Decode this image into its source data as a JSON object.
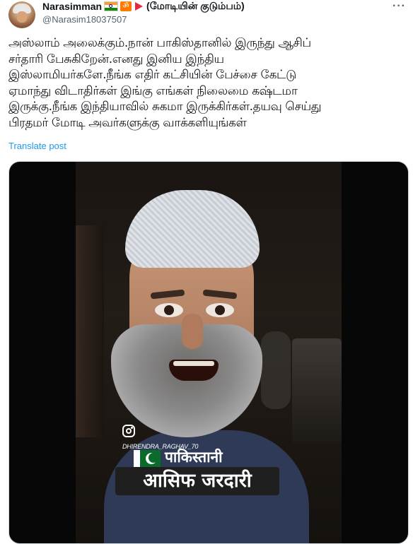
{
  "tweet": {
    "author": {
      "display_name": "Narasimman",
      "name_emojis": [
        "india-flag-icon",
        "om-icon",
        "red-pennant-icon"
      ],
      "tagline": "(மோடியின் குடும்பம்)",
      "handle": "@Narasim18037507"
    },
    "more_icon_label": "···",
    "text_lines": [
      "அஸ்லாம் அலைக்கும்.நான் பாகிஸ்தானில் இருந்து ஆசிப்",
      "சர்தாரி பேசுகிறேன்.எனது இனிய இந்திய",
      "இஸ்லாமியர்களே.நீங்க எதிர் கட்சியின் பேச்சை கேட்டு",
      "ஏமாந்து விடாதிர்கள் இங்கு எங்கள் நிலைமை கஷ்டமா",
      "இருக்கு.நீங்க இந்தியாவில் சுகமா இருக்கிர்கள்.தயவு செய்து",
      "பிரதமர் மோடி  அவர்களுக்கு வாக்களியுங்கள்"
    ],
    "translate_label": "Translate post",
    "media": {
      "watermark": "DHIRENDRA_RAGHAV_70",
      "caption_top": "पाकिस्तानी",
      "caption_main": "आसिफ जरदारी"
    }
  },
  "colors": {
    "text": "#0f1419",
    "secondary": "#536471",
    "link": "#1d9bf0",
    "pennant": "#e8283c",
    "om_badge": "#ff7a00"
  }
}
